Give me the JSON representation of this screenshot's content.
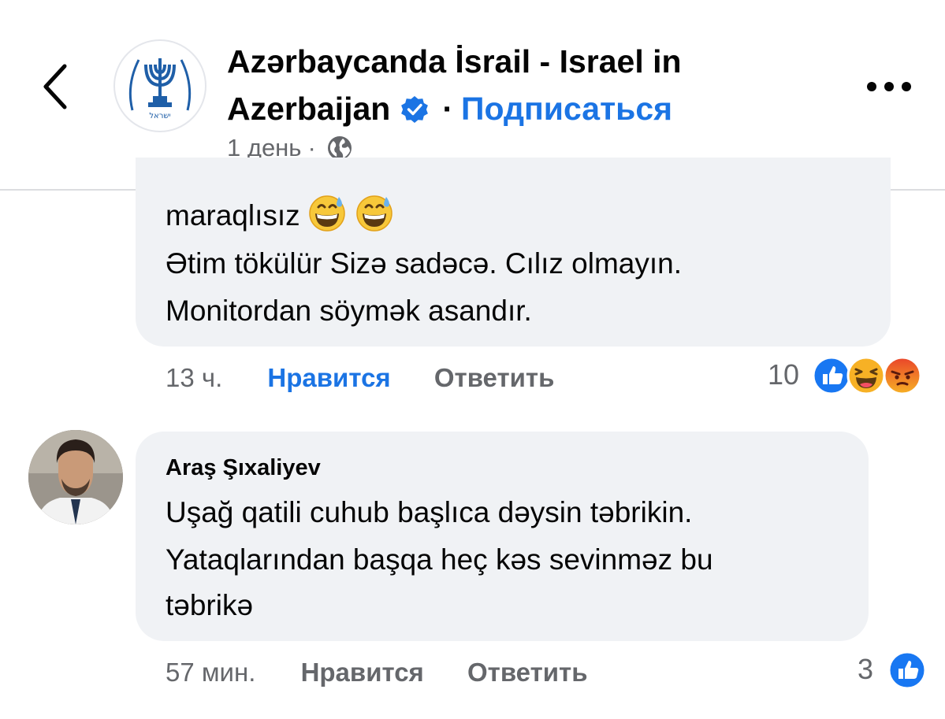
{
  "header": {
    "page_name": "Azərbaycanda İsrail - Israel in Azerbaijan",
    "page_name_line1": "Azərbaycanda İsrail - Israel in",
    "page_name_line2": "Azerbaijan",
    "dot": "·",
    "follow_label": "Подписаться",
    "post_time": "1 день",
    "meta_sep": "·",
    "privacy_icon": "globe-icon",
    "verified_icon": "verified-badge-icon",
    "back_icon": "chevron-left-icon",
    "more_icon": "more-horizontal-icon",
    "emblem_text": "ישראל"
  },
  "comments": [
    {
      "lines": [
        "maraqlısız",
        "Ətim tökülür Sizə sadəcə. Cılız olmayın.",
        "Monitordan söymək asandır."
      ],
      "emojis": [
        "grinning-sweat-emoji",
        "grinning-sweat-emoji"
      ],
      "time": "13 ч.",
      "like_label": "Нравится",
      "reply_label": "Ответить",
      "reaction_count": "10",
      "reactions": [
        "like-reaction-icon",
        "haha-reaction-icon",
        "angry-reaction-icon"
      ]
    },
    {
      "author": "Araş Şıxaliyev",
      "lines": [
        "Uşağ qatili cuhub başlıca dəysin təbrikin.",
        "Yataqlarından başqa heç kəs sevinməz bu",
        "təbrikə"
      ],
      "time": "57 мин.",
      "like_label": "Нравится",
      "reply_label": "Ответить",
      "reaction_count": "3",
      "reactions": [
        "like-reaction-icon"
      ]
    }
  ],
  "colors": {
    "accent": "#1b74e4",
    "secondary_text": "#65676b",
    "bubble": "#f0f2f5",
    "like_blue": "#1877f2",
    "haha_yellow": "#f7b125",
    "angry_orange": "#e9710f"
  }
}
